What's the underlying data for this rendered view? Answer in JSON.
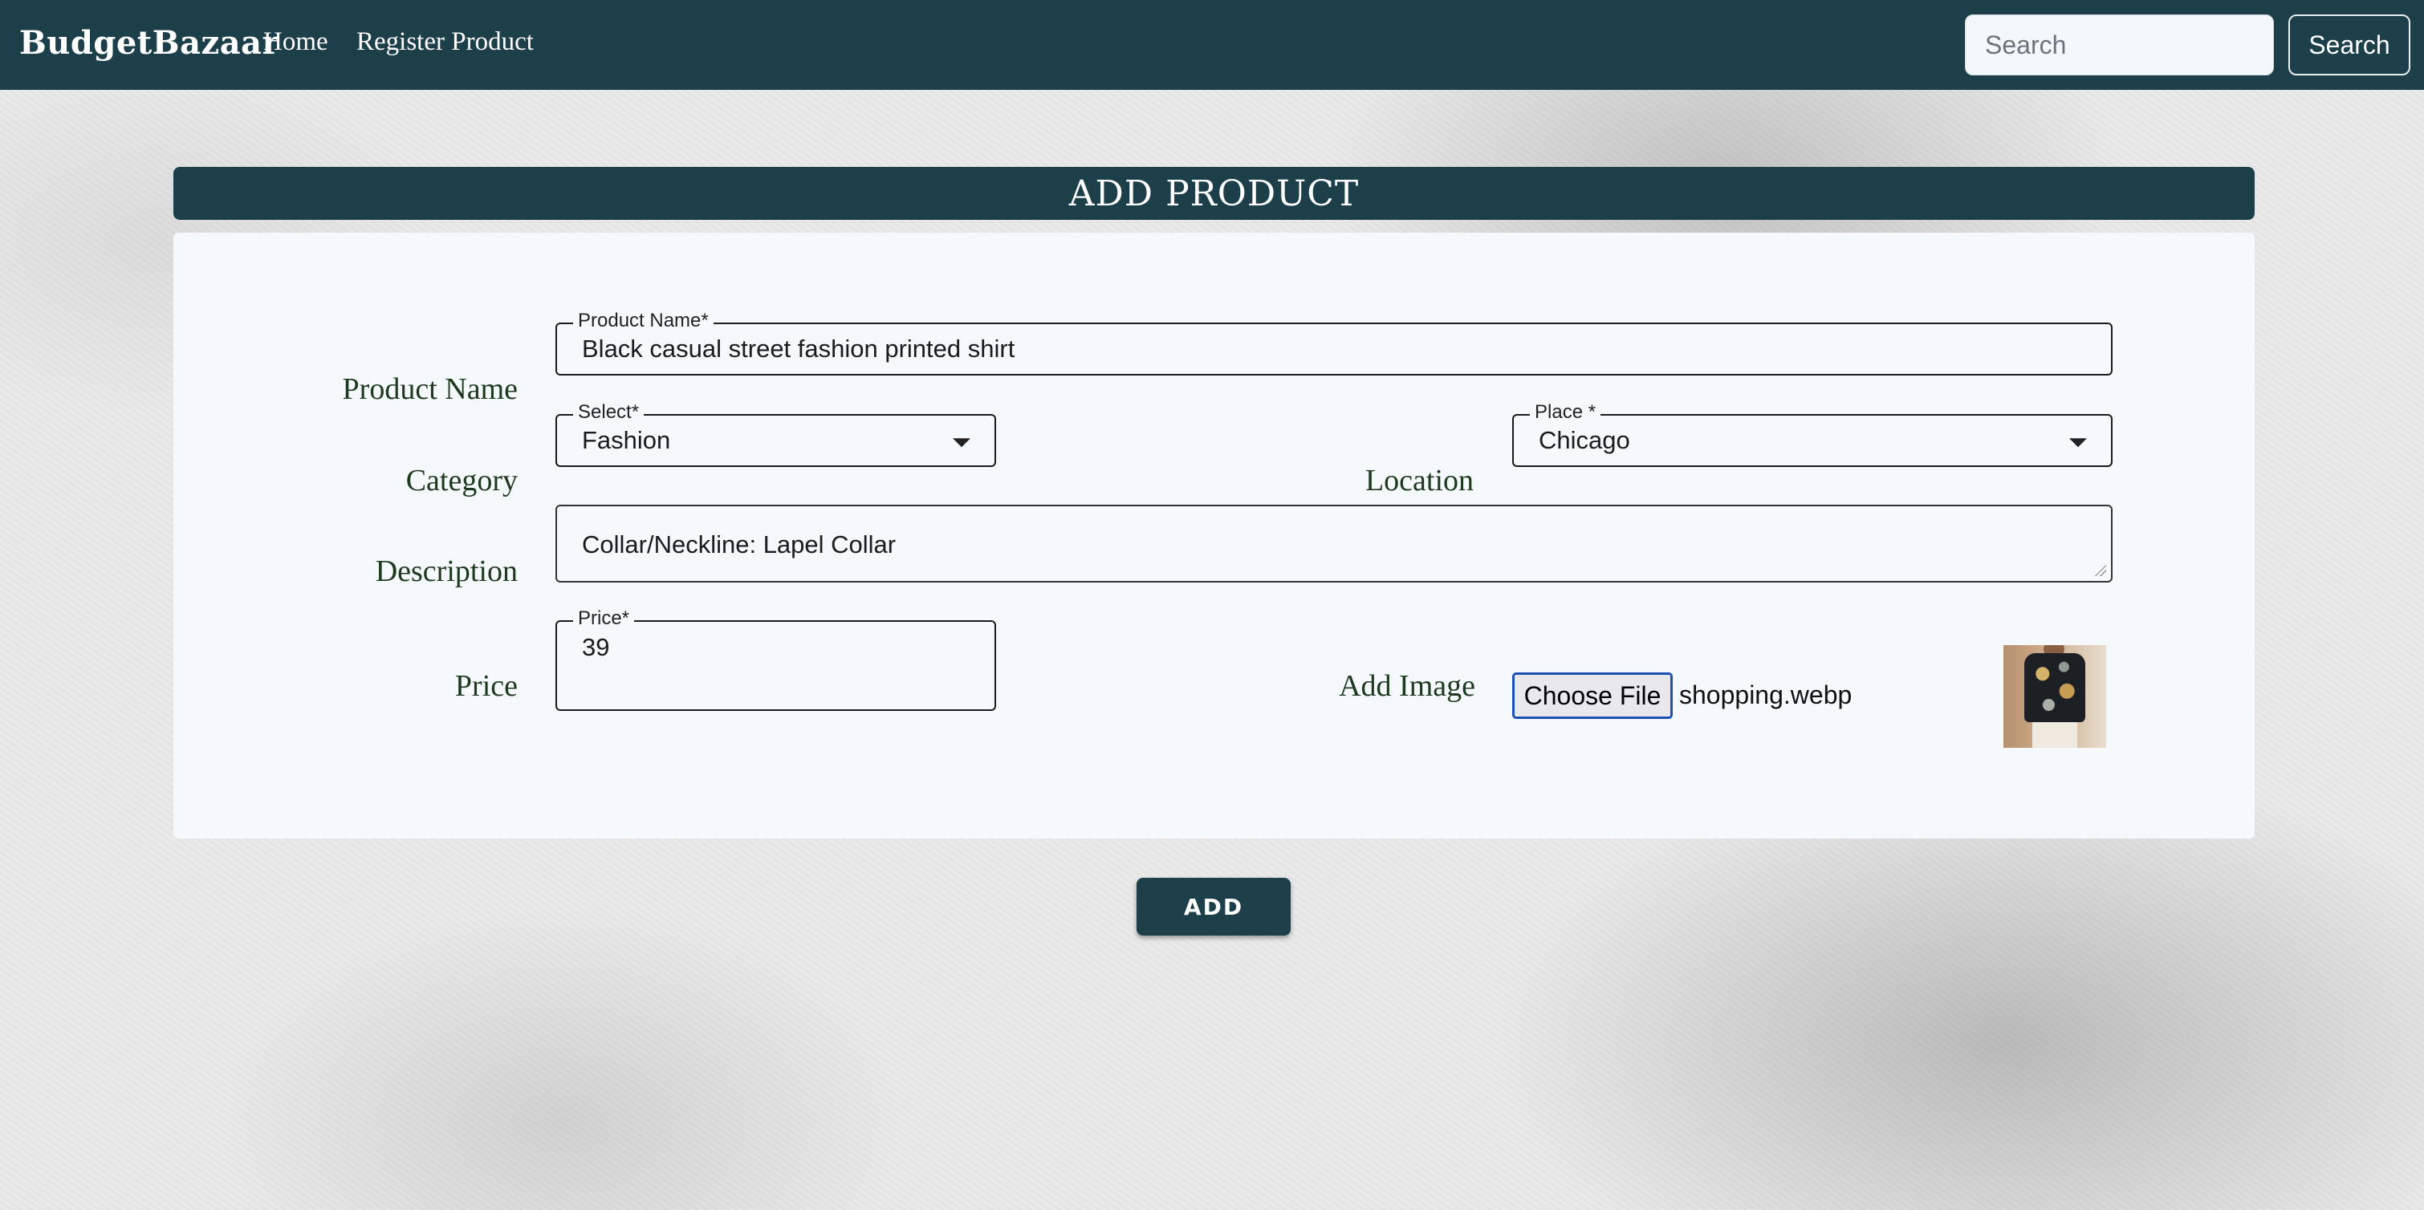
{
  "navbar": {
    "brand": "BudgetBazaar",
    "links": [
      "Home",
      "Register Product"
    ],
    "search": {
      "placeholder": "Search",
      "value": ""
    },
    "search_button": "Search"
  },
  "form": {
    "title": "ADD PRODUCT",
    "labels": {
      "product_name": "Product Name",
      "category": "Category",
      "description": "Description",
      "price": "Price",
      "location": "Location",
      "add_image": "Add Image"
    },
    "fields": {
      "product_name": {
        "legend": "Product Name*",
        "value": "Black casual street fashion printed shirt"
      },
      "category": {
        "legend": "Select*",
        "value": "Fashion"
      },
      "place": {
        "legend": "Place *",
        "value": "Chicago"
      },
      "description": {
        "value": "Collar/Neckline: Lapel Collar"
      },
      "price": {
        "legend": "Price*",
        "value": "39"
      }
    },
    "file": {
      "button": "Choose File",
      "name": "shopping.webp"
    },
    "submit": "ADD"
  },
  "colors": {
    "primary": "#1c3f4a",
    "panel": "#f5f9fb",
    "label": "#1e3a1e"
  }
}
